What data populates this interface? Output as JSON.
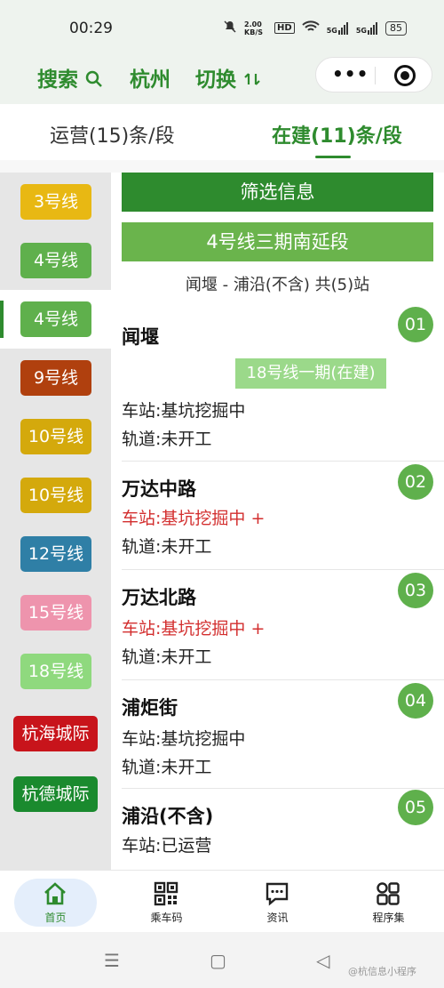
{
  "status": {
    "time": "00:29",
    "speed": "2.00 KB/S",
    "hd": "HD",
    "net1": "5G",
    "net2": "5G",
    "battery": "85"
  },
  "nav": {
    "search": "搜索",
    "city": "杭州",
    "switch": "切换"
  },
  "tabs": {
    "operating": "运营(15)条/段",
    "building": "在建(11)条/段"
  },
  "sidebar": {
    "items": [
      {
        "label": "3号线",
        "color": "#e8b813"
      },
      {
        "label": "4号线",
        "color": "#5fb04c"
      },
      {
        "label": "4号线",
        "color": "#5fb04c"
      },
      {
        "label": "9号线",
        "color": "#b0400e"
      },
      {
        "label": "10号线",
        "color": "#d4a90c"
      },
      {
        "label": "10号线",
        "color": "#d4a90c"
      },
      {
        "label": "12号线",
        "color": "#2f7fa6"
      },
      {
        "label": "15号线",
        "color": "#ee94ad"
      },
      {
        "label": "18号线",
        "color": "#8fd97e"
      },
      {
        "label": "杭海城际",
        "color": "#c8141b"
      },
      {
        "label": "杭德城际",
        "color": "#1a8a2e"
      }
    ]
  },
  "main": {
    "filter": "筛选信息",
    "section": "4号线三期南延段",
    "range": "闻堰 - 浦沿(不含) 共(5)站",
    "stations": [
      {
        "num": "01",
        "name": "闻堰",
        "transfer": "18号线一期(在建)",
        "station": "车站:基坑挖掘中",
        "track": "轨道:未开工"
      },
      {
        "num": "02",
        "name": "万达中路",
        "station": "车站:基坑挖掘中 +",
        "track": "轨道:未开工"
      },
      {
        "num": "03",
        "name": "万达北路",
        "station": "车站:基坑挖掘中 +",
        "track": "轨道:未开工"
      },
      {
        "num": "04",
        "name": "浦炬街",
        "station": "车站:基坑挖掘中",
        "track": "轨道:未开工"
      },
      {
        "num": "05",
        "name": "浦沿(不含)",
        "station": "车站:已运营"
      }
    ]
  },
  "tabbar": {
    "home": "首页",
    "qr": "乘车码",
    "news": "资讯",
    "apps": "程序集"
  },
  "system": {
    "menu": "☰",
    "home": "▢",
    "back": "◁"
  },
  "watermark": "@杭信息小程序"
}
